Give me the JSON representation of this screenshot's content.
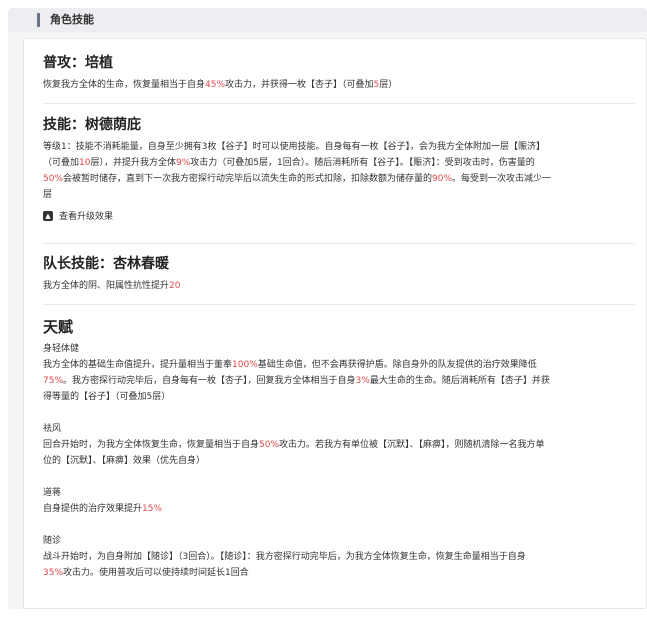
{
  "header": {
    "title": "角色技能"
  },
  "normal": {
    "title": "普攻：培植",
    "desc": [
      "恢复我方全体的生命，恢复量相当于自身",
      "45%",
      "攻击力，并获得一枚【杏子】（可叠加",
      "5",
      "层）"
    ]
  },
  "skill": {
    "title": "技能：树德荫庇",
    "line1": "等级1：技能不消耗能量，自身至少拥有3枚【谷子】时可以使用技能。自身每有一枚【谷子】，会为我方全体附加一层【赈济】",
    "line2": [
      "（可叠加",
      "10",
      "层），并提升我方全体",
      "9%",
      "攻击力（可叠加5层，1回合）。随后消耗所有【谷子】。【赈济】：受到攻击时，伤害量的"
    ],
    "line3": [
      "50%",
      "会被暂时储存，直到下一次我方密探行动完毕后以流失生命的形式扣除，扣除数额为储存量的",
      "90%",
      "。每受到一次攻击减少一"
    ],
    "line4": "层",
    "expand_label": "查看升级效果"
  },
  "leader": {
    "title": "队长技能：杏林春暖",
    "desc": [
      "我方全体的阴、阳属性抗性提升",
      "20"
    ]
  },
  "talent": {
    "title": "天赋",
    "items": [
      {
        "name": "身轻体健",
        "l1": [
          "我方全体的基础生命值提升，提升量相当于董奉",
          "100%",
          "基础生命值，但不会再获得护盾。除自身外的队友提供的治疗效果降低"
        ],
        "l2": [
          "75%",
          "。我方密探行动完毕后，自身每有一枚【杏子】，回复我方全体相当于自身",
          "3%",
          "最大生命的生命。随后消耗所有【杏子】并获"
        ],
        "l3": "得等量的【谷子】（可叠加5层）"
      },
      {
        "name": "祛风",
        "l1": [
          "回合开始时，为我方全体恢复生命，恢复量相当于自身",
          "50%",
          "攻击力。若我方有单位被【沉默】、【麻痹】，则随机清除一名我方单"
        ],
        "l2": "位的【沉默】、【麻痹】效果（优先自身）"
      },
      {
        "name": "道蒋",
        "l1": [
          "自身提供的治疗效果提升",
          "15%"
        ]
      },
      {
        "name": "随诊",
        "l1": [
          "战斗开始时，为自身附加【随诊】（3回合）。【随诊】：我方密探行动完毕后，为我方全体恢复生命，恢复生命量相当于自身"
        ],
        "l2": [
          "35%",
          "攻击力。使用普攻后可以使持续时间延长1回合"
        ]
      }
    ]
  },
  "colors": {
    "highlight": "#e04a4a",
    "accent_bar": "#6f7486"
  }
}
